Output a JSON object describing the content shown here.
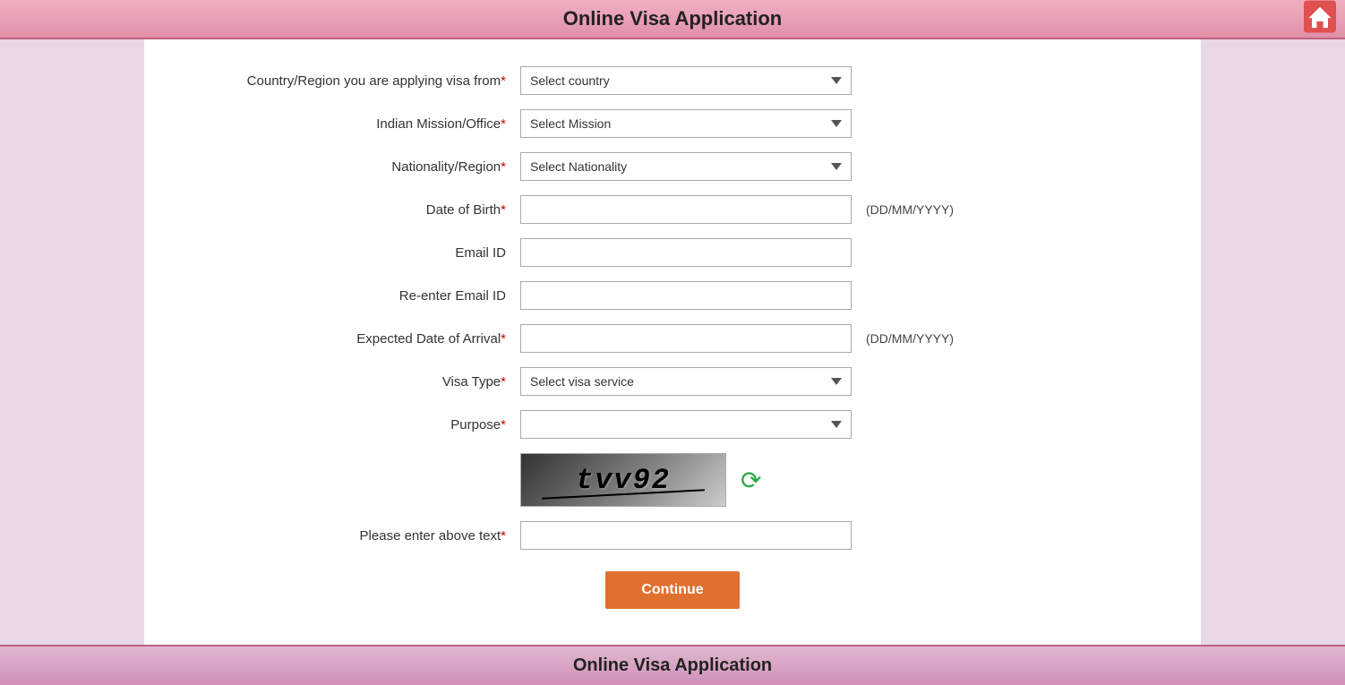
{
  "header": {
    "title": "Online Visa Application",
    "home_icon_label": "home"
  },
  "footer": {
    "title": "Online Visa Application"
  },
  "form": {
    "fields": [
      {
        "id": "country",
        "label": "Country/Region you are applying visa from",
        "required": true,
        "type": "select",
        "placeholder": "Select country",
        "suffix": ""
      },
      {
        "id": "mission",
        "label": "Indian Mission/Office",
        "required": true,
        "type": "select",
        "placeholder": "Select Mission",
        "suffix": ""
      },
      {
        "id": "nationality",
        "label": "Nationality/Region",
        "required": true,
        "type": "select",
        "placeholder": "Select Nationality",
        "suffix": ""
      },
      {
        "id": "dob",
        "label": "Date of Birth",
        "required": true,
        "type": "text",
        "placeholder": "",
        "suffix": "(DD/MM/YYYY)"
      },
      {
        "id": "email",
        "label": "Email ID",
        "required": false,
        "type": "text",
        "placeholder": "",
        "suffix": ""
      },
      {
        "id": "reenter_email",
        "label": "Re-enter Email ID",
        "required": false,
        "type": "text",
        "placeholder": "",
        "suffix": ""
      },
      {
        "id": "arrival_date",
        "label": "Expected Date of Arrival",
        "required": true,
        "type": "text",
        "placeholder": "",
        "suffix": "(DD/MM/YYYY)"
      },
      {
        "id": "visa_type",
        "label": "Visa Type",
        "required": true,
        "type": "select",
        "placeholder": "Select visa service",
        "suffix": ""
      },
      {
        "id": "purpose",
        "label": "Purpose",
        "required": true,
        "type": "select",
        "placeholder": "",
        "suffix": ""
      }
    ],
    "captcha_text": "tvv92",
    "captcha_label": "Please enter above text",
    "captcha_required": true,
    "continue_button": "Continue"
  }
}
